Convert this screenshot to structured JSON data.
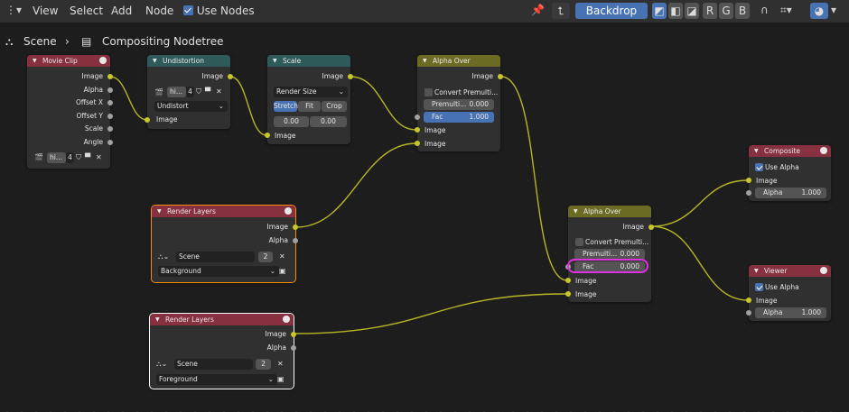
{
  "header": {
    "menu": [
      "View",
      "Select",
      "Add",
      "Node"
    ],
    "use_nodes_label": "Use Nodes",
    "backdrop_label": "Backdrop",
    "channel_buttons": [
      "R",
      "G",
      "B"
    ]
  },
  "breadcrumb": {
    "scene": "Scene",
    "tree": "Compositing Nodetree"
  },
  "nodes": {
    "movie_clip": {
      "title": "Movie Clip",
      "outputs": [
        "Image",
        "Alpha",
        "Offset X",
        "Offset Y",
        "Scale",
        "Angle"
      ],
      "clip_name": "hi...",
      "clip_users": "4"
    },
    "undistortion": {
      "title": "Undistortion",
      "output": "Image",
      "input": "Image",
      "clip_name": "hi...",
      "clip_users": "4",
      "mode": "Undistort"
    },
    "scale": {
      "title": "Scale",
      "output": "Image",
      "input": "Image",
      "space": "Render Size",
      "fit_buttons": [
        "Stretch",
        "Fit",
        "Crop"
      ],
      "offset_x": "0.00",
      "offset_y": "0.00"
    },
    "alpha_over_top": {
      "title": "Alpha Over",
      "output": "Image",
      "convert_label": "Convert Premulti...",
      "premulti_label": "Premulti...",
      "premulti_value": "0.000",
      "fac_label": "Fac",
      "fac_value": "1.000",
      "inputs": [
        "Image",
        "Image"
      ]
    },
    "render_layers_bg": {
      "title": "Render Layers",
      "outputs": [
        "Image",
        "Alpha"
      ],
      "scene": "Scene",
      "scene_users": "2",
      "layer": "Background"
    },
    "alpha_over_bottom": {
      "title": "Alpha Over",
      "output": "Image",
      "convert_label": "Convert Premulti...",
      "premulti_label": "Premulti...",
      "premulti_value": "0.000",
      "fac_label": "Fac",
      "fac_value": "0.000",
      "inputs": [
        "Image",
        "Image"
      ]
    },
    "render_layers_fg": {
      "title": "Render Layers",
      "outputs": [
        "Image",
        "Alpha"
      ],
      "scene": "Scene",
      "scene_users": "2",
      "layer": "Foreground"
    },
    "composite": {
      "title": "Composite",
      "use_alpha_label": "Use Alpha",
      "input": "Image",
      "alpha_label": "Alpha",
      "alpha_value": "1.000"
    },
    "viewer": {
      "title": "Viewer",
      "use_alpha_label": "Use Alpha",
      "input": "Image",
      "alpha_label": "Alpha",
      "alpha_value": "1.000"
    }
  },
  "colors": {
    "image_socket": "#c7c729",
    "value_socket": "#a1a1a1",
    "accent": "#4772b3",
    "highlight_circle": "#e030e0",
    "selected_outline": "#ff8c00"
  }
}
